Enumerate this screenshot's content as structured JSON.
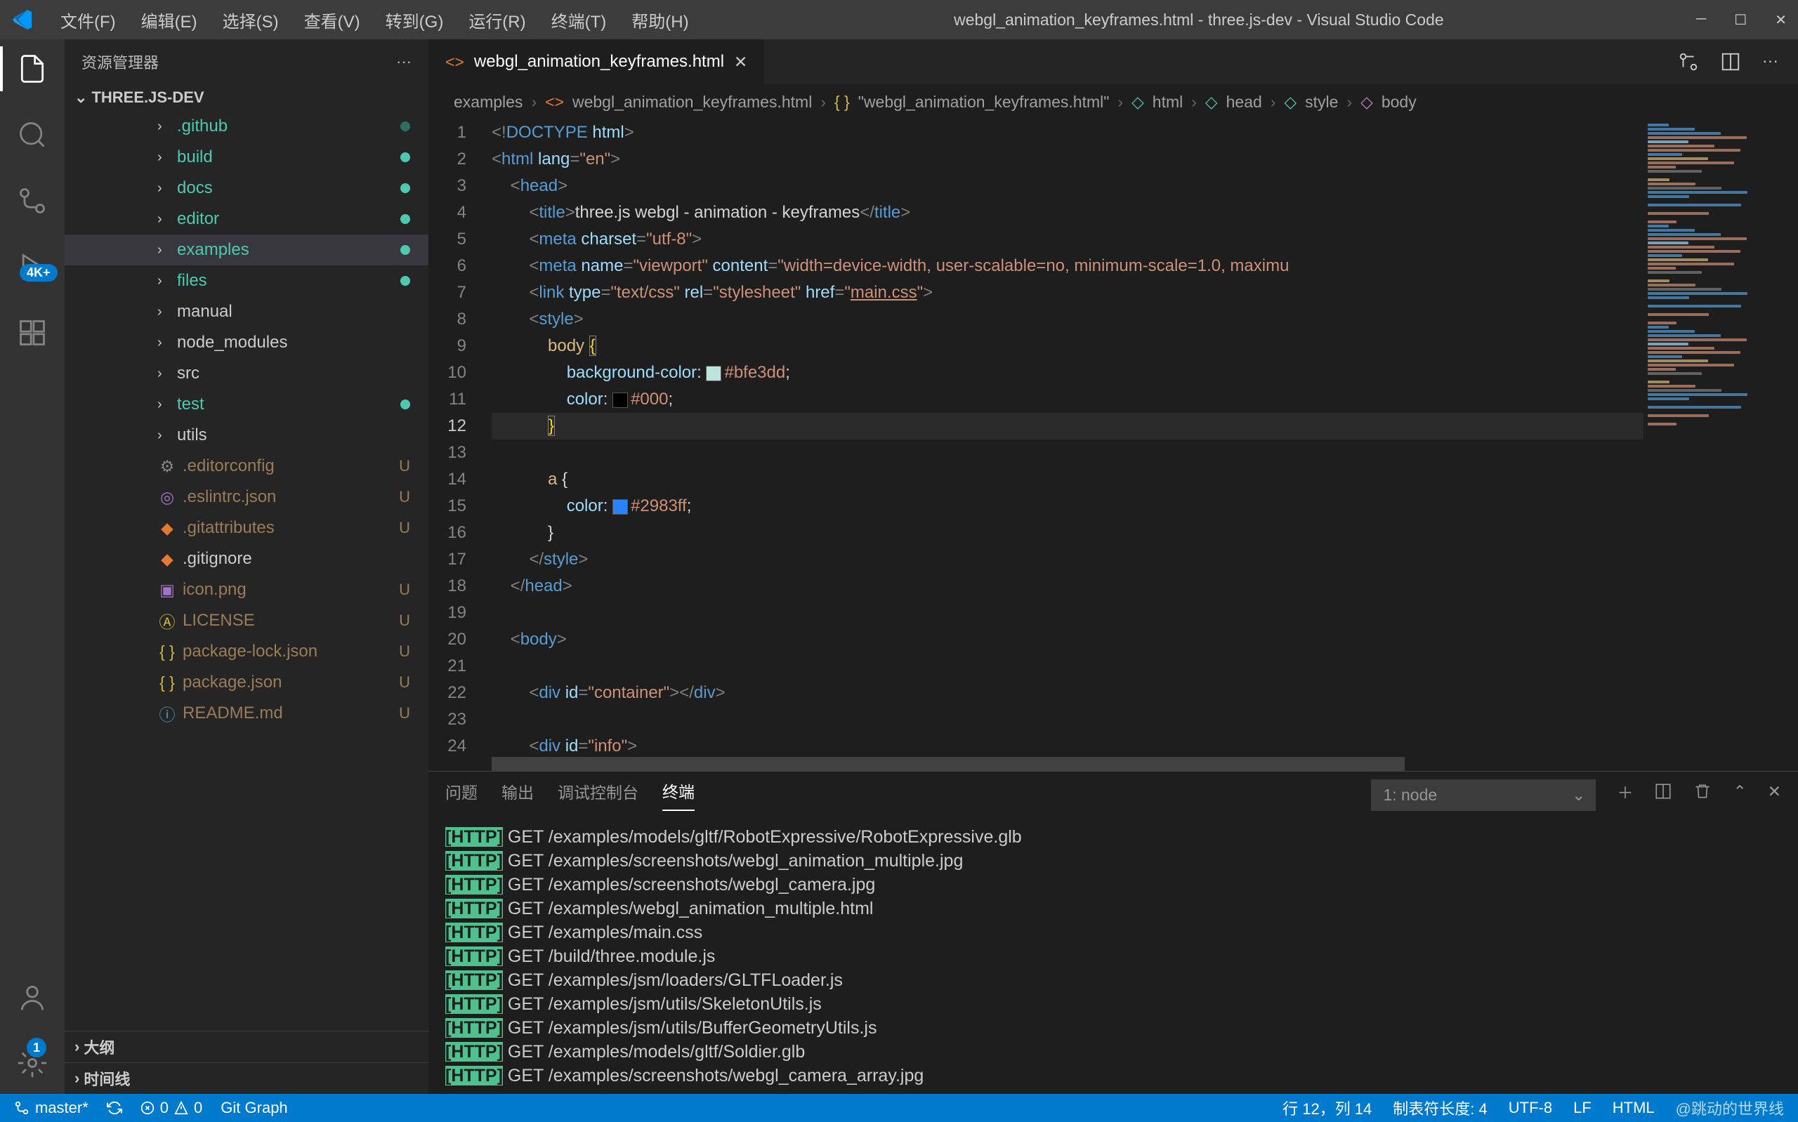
{
  "window": {
    "title": "webgl_animation_keyframes.html - three.js-dev - Visual Studio Code"
  },
  "menu": [
    "文件(F)",
    "编辑(E)",
    "选择(S)",
    "查看(V)",
    "转到(G)",
    "运行(R)",
    "终端(T)",
    "帮助(H)"
  ],
  "activity_bar": {
    "badge_source_control": "4K+",
    "badge_settings": "1"
  },
  "sidebar": {
    "title": "资源管理器",
    "root": "THREE.JS-DEV",
    "tree": [
      {
        "label": ".github",
        "type": "folder",
        "status": "dot-darkteal"
      },
      {
        "label": "build",
        "type": "folder",
        "status": "dot-teal"
      },
      {
        "label": "docs",
        "type": "folder",
        "status": "dot-teal"
      },
      {
        "label": "editor",
        "type": "folder",
        "status": "dot-teal"
      },
      {
        "label": "examples",
        "type": "folder",
        "status": "dot-teal",
        "selected": true
      },
      {
        "label": "files",
        "type": "folder",
        "status": "dot-teal"
      },
      {
        "label": "manual",
        "type": "folder"
      },
      {
        "label": "node_modules",
        "type": "folder"
      },
      {
        "label": "src",
        "type": "folder"
      },
      {
        "label": "test",
        "type": "folder",
        "status": "dot-teal"
      },
      {
        "label": "utils",
        "type": "folder"
      },
      {
        "label": ".editorconfig",
        "type": "file",
        "icon": "gear",
        "color": "#858585",
        "status": "U"
      },
      {
        "label": ".eslintrc.json",
        "type": "file",
        "icon": "target",
        "color": "#a074c4",
        "status": "U"
      },
      {
        "label": ".gitattributes",
        "type": "file",
        "icon": "git",
        "color": "#e37933",
        "status": "U"
      },
      {
        "label": ".gitignore",
        "type": "file",
        "icon": "git",
        "color": "#e37933"
      },
      {
        "label": "icon.png",
        "type": "file",
        "icon": "image",
        "color": "#a074c4",
        "status": "U"
      },
      {
        "label": "LICENSE",
        "type": "file",
        "icon": "license",
        "color": "#d4b73e",
        "status": "U"
      },
      {
        "label": "package-lock.json",
        "type": "file",
        "icon": "braces",
        "color": "#d4b73e",
        "status": "U"
      },
      {
        "label": "package.json",
        "type": "file",
        "icon": "braces",
        "color": "#d4b73e",
        "status": "U"
      },
      {
        "label": "README.md",
        "type": "file",
        "icon": "info",
        "color": "#519aba",
        "status": "U"
      }
    ],
    "outline": "大纲",
    "timeline": "时间线"
  },
  "tab": {
    "name": "webgl_animation_keyframes.html"
  },
  "breadcrumbs": [
    "examples",
    "webgl_animation_keyframes.html",
    "\"webgl_animation_keyframes.html\"",
    "html",
    "head",
    "style",
    "body"
  ],
  "editor": {
    "first_line": 1,
    "last_line": 24,
    "current_line": 12
  },
  "panel": {
    "tabs": [
      "问题",
      "输出",
      "调试控制台",
      "终端"
    ],
    "active_tab": 3,
    "terminal_select": "1: node",
    "terminal_lines": [
      "GET /examples/models/gltf/RobotExpressive/RobotExpressive.glb",
      "GET /examples/screenshots/webgl_animation_multiple.jpg",
      "GET /examples/screenshots/webgl_camera.jpg",
      "GET /examples/webgl_animation_multiple.html",
      "GET /examples/main.css",
      "GET /build/three.module.js",
      "GET /examples/jsm/loaders/GLTFLoader.js",
      "GET /examples/jsm/utils/SkeletonUtils.js",
      "GET /examples/jsm/utils/BufferGeometryUtils.js",
      "GET /examples/models/gltf/Soldier.glb",
      "GET /examples/screenshots/webgl_camera_array.jpg"
    ],
    "http_tag": "[HTTP]"
  },
  "status": {
    "branch": "master*",
    "errors": "0",
    "warnings": "0",
    "git_graph": "Git Graph",
    "cursor": "行 12，列 14",
    "tab_size": "制表符长度: 4",
    "encoding": "UTF-8",
    "eol": "LF",
    "language": "HTML",
    "watermark": "@跳动的世界线"
  }
}
